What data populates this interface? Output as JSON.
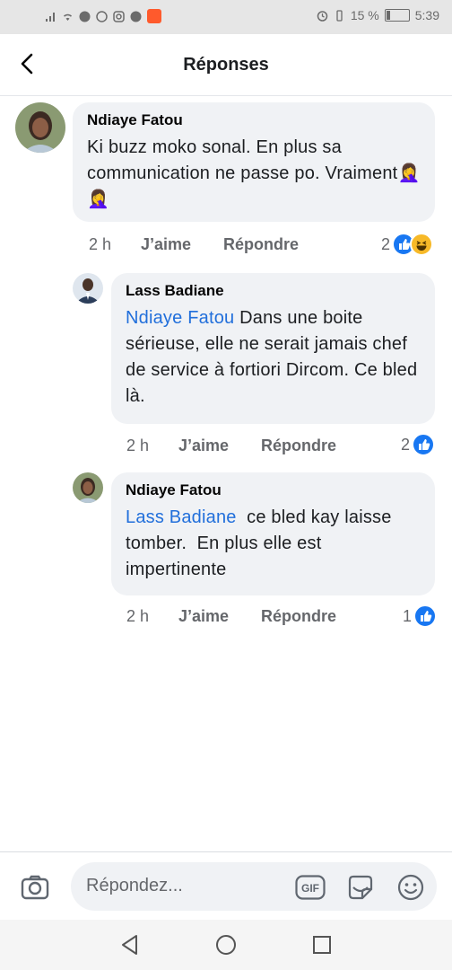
{
  "status_bar": {
    "battery": "15 %",
    "time": "5:39"
  },
  "header": {
    "title": "Réponses"
  },
  "comments": [
    {
      "author": "Ndiaye Fatou",
      "mention": "",
      "text": "Ki buzz moko sonal. En plus sa communication ne passe po. Vraiment",
      "emoji": "🤦‍♀️🤦‍♀️",
      "time": "2 h",
      "like_label": "J’aime",
      "reply_label": "Répondre",
      "reaction_count": "2",
      "reactions": [
        "like-icon",
        "haha-icon"
      ]
    },
    {
      "author": "Lass Badiane",
      "mention": "Ndiaye Fatou",
      "text": " Dans une boite sérieuse, elle ne serait jamais chef de service à fortiori Dircom. Ce bled là.",
      "time": "2 h",
      "like_label": "J’aime",
      "reply_label": "Répondre",
      "reaction_count": "2",
      "reactions": [
        "like-icon"
      ]
    },
    {
      "author": "Ndiaye Fatou",
      "mention": "Lass Badiane",
      "text": "  ce bled kay laisse tomber.  En plus elle est impertinente",
      "time": "2 h",
      "like_label": "J’aime",
      "reply_label": "Répondre",
      "reaction_count": "1",
      "reactions": [
        "like-icon"
      ]
    }
  ],
  "composer": {
    "placeholder": "Répondez...",
    "gif_label": "GIF"
  },
  "colors": {
    "accent": "#1877f2",
    "mention": "#216fdb",
    "bubble": "#f0f2f5",
    "meta_text": "#65676b"
  }
}
